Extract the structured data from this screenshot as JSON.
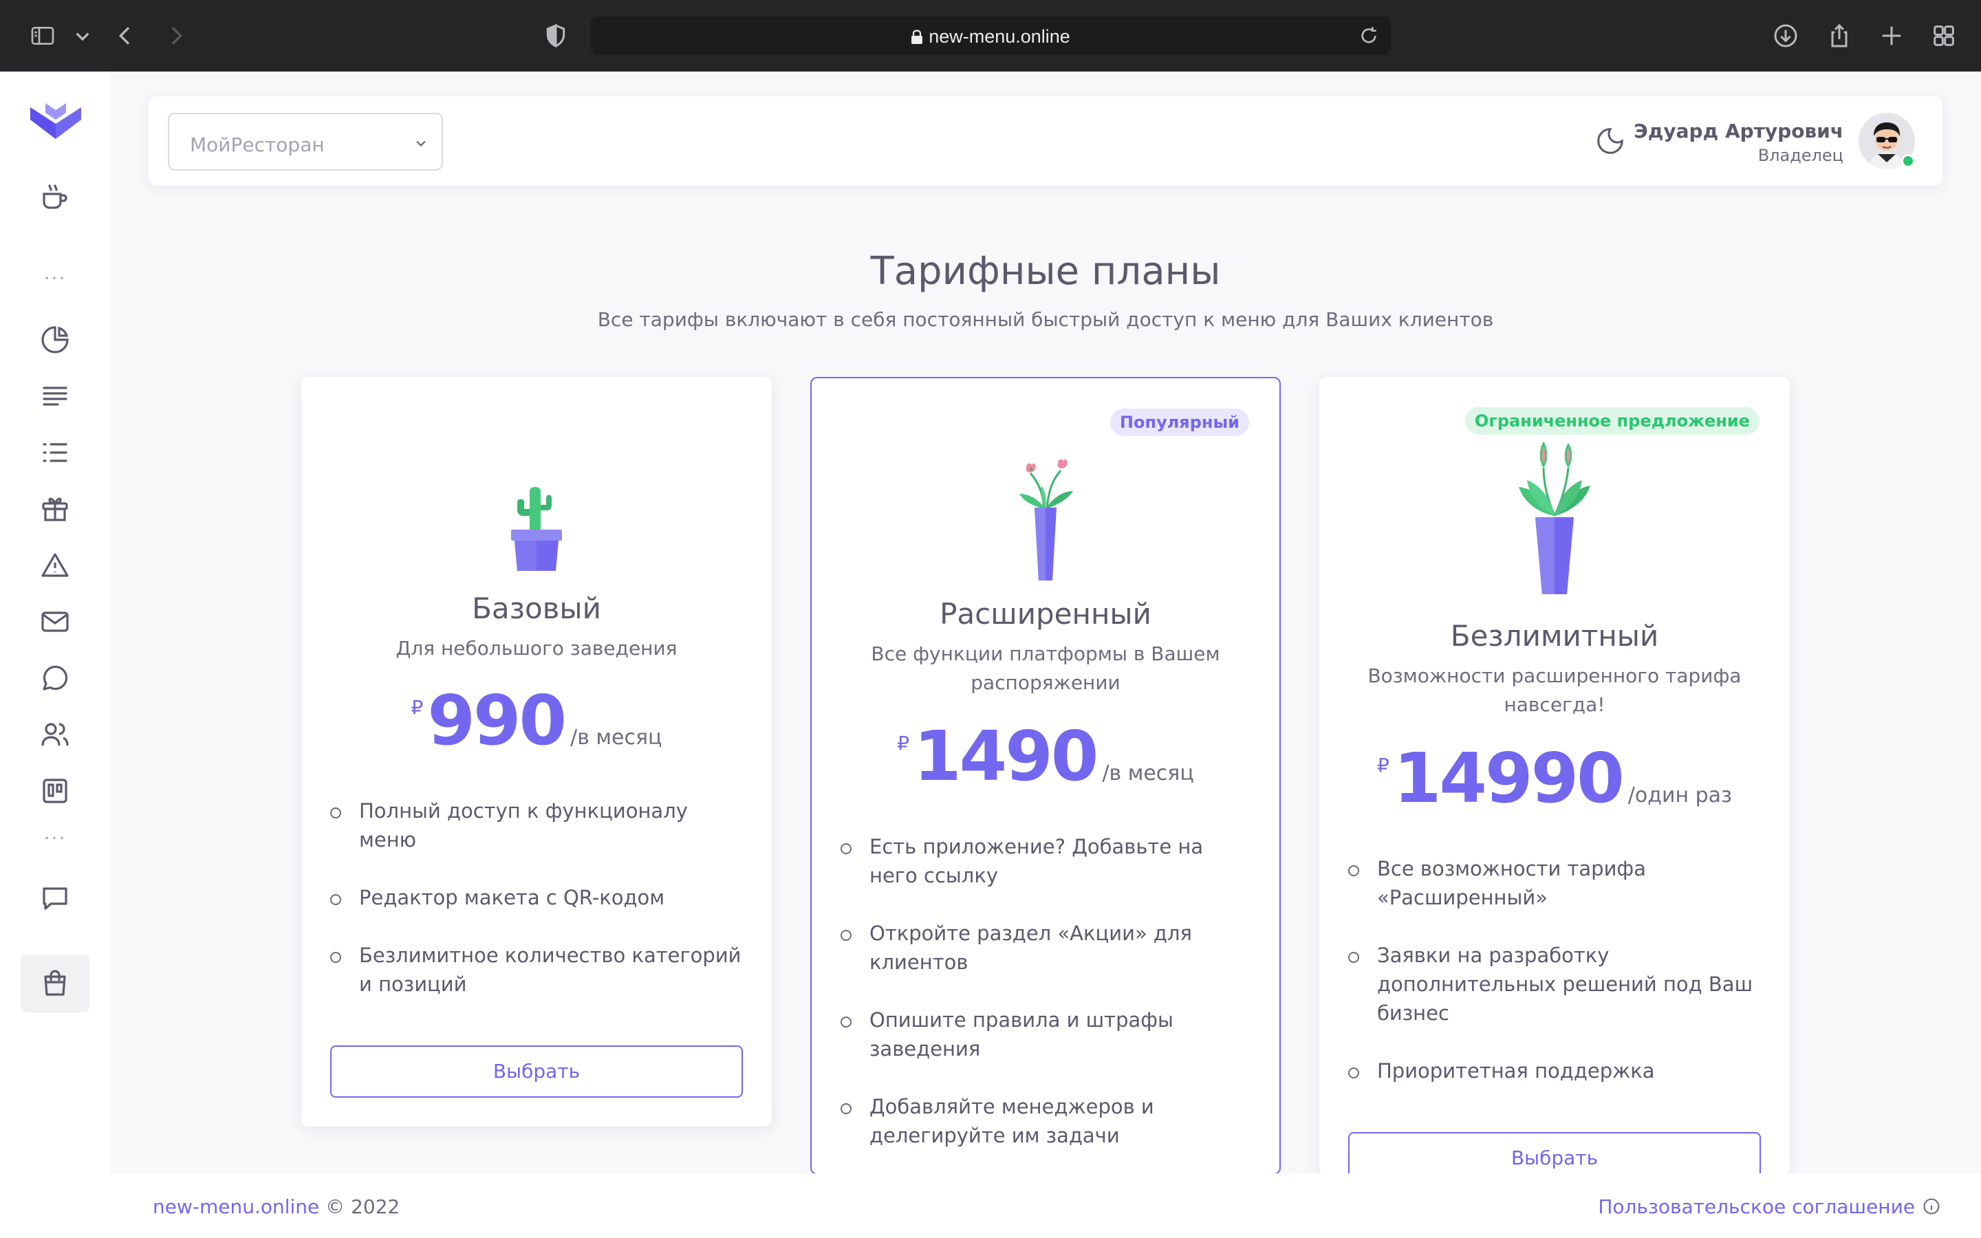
{
  "browser": {
    "url": "new-menu.online"
  },
  "sidebar": {
    "icons": [
      "coffee-icon",
      "pie-chart-icon",
      "align-left-icon",
      "list-icon",
      "gift-icon",
      "alert-triangle-icon",
      "mail-icon",
      "message-circle-icon",
      "users-icon",
      "layout-board-icon",
      "message-square-icon",
      "shopping-bag-icon"
    ]
  },
  "header": {
    "restaurant_select": "МойРесторан",
    "user_name": "Эдуард Артурович",
    "user_role": "Владелец"
  },
  "page": {
    "title": "Тарифные планы",
    "subtitle": "Все тарифы включают в себя постоянный быстрый доступ к меню для Ваших клиентов"
  },
  "plans": [
    {
      "name": "Базовый",
      "description": "Для небольшого заведения",
      "currency": "₽",
      "price": "990",
      "period": "/в месяц",
      "features": [
        "Полный доступ к функционалу меню",
        "Редактор макета с QR-кодом",
        "Безлимитное количество категорий и позиций"
      ],
      "button": "Выбрать"
    },
    {
      "badge": "Популярный",
      "name": "Расширенный",
      "description": "Все функции платформы в Вашем распоряжении",
      "currency": "₽",
      "price": "1490",
      "period": "/в месяц",
      "features": [
        "Есть приложение? Добавьте на него ссылку",
        "Откройте раздел «Акции» для клиентов",
        "Опишите правила и штрафы заведения",
        "Добавляйте менеджеров и делегируйте им задачи"
      ]
    },
    {
      "badge": "Ограниченное предложение",
      "name": "Безлимитный",
      "description": "Возможности расширенного тарифа навсегда!",
      "currency": "₽",
      "price": "14990",
      "period": "/один раз",
      "features": [
        "Все возможности тарифа «Расширенный»",
        "Заявки на разработку дополнительных решений под Ваш бизнес",
        "Приоритетная поддержка"
      ],
      "button": "Выбрать"
    }
  ],
  "footer": {
    "site_link": "new-menu.online",
    "copyright": " © 2022",
    "agreement": "Пользовательское соглашение"
  },
  "colors": {
    "primary": "#7367f0",
    "success": "#28c76f",
    "background": "#f8f7fa"
  }
}
